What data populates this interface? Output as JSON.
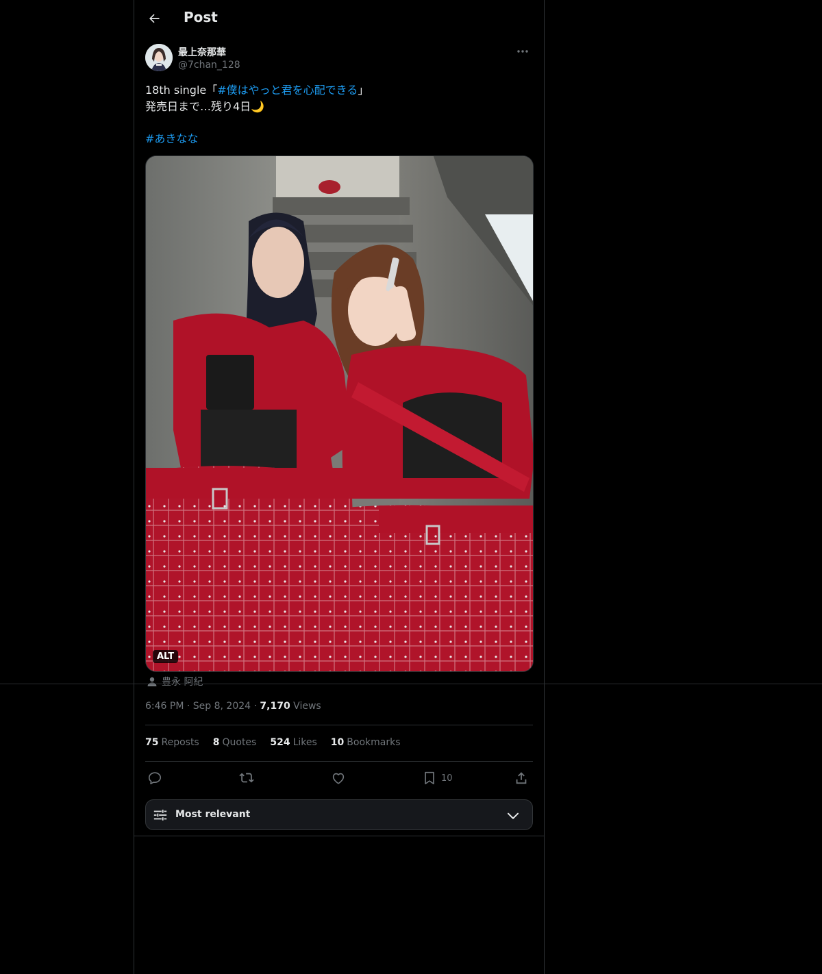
{
  "header": {
    "title": "Post"
  },
  "author": {
    "display_name": "最上奈那華",
    "handle": "@7chan_128"
  },
  "tweet": {
    "text_prefix": "18th single「",
    "hashtag_1": "#僕はやっと君を心配できる",
    "text_suffix": "」",
    "line_2": "発売日まで…残り4日🌙",
    "hashtag_2": "#あきなな"
  },
  "media": {
    "alt_badge": "ALT",
    "tagged_user": "豊永 阿紀"
  },
  "meta": {
    "time": "6:46 PM",
    "separator_1": " · ",
    "date": "Sep 8, 2024",
    "separator_2": " · ",
    "views_count": "7,170",
    "views_label": " Views"
  },
  "stats": [
    {
      "count": "75",
      "label": "Reposts"
    },
    {
      "count": "8",
      "label": "Quotes"
    },
    {
      "count": "524",
      "label": "Likes"
    },
    {
      "count": "10",
      "label": "Bookmarks"
    }
  ],
  "actions": {
    "bookmark_count": "10"
  },
  "sort": {
    "label": "Most relevant"
  },
  "icons": [
    "back-arrow-icon",
    "more-icon",
    "person-icon",
    "reply-icon",
    "repost-icon",
    "like-icon",
    "bookmark-icon",
    "share-icon",
    "sliders-icon",
    "chevron-down-icon"
  ],
  "colors": {
    "background": "#000000",
    "text": "#e7e9ea",
    "secondary": "#71767b",
    "link": "#1d9bf0",
    "border": "#2f3336"
  }
}
